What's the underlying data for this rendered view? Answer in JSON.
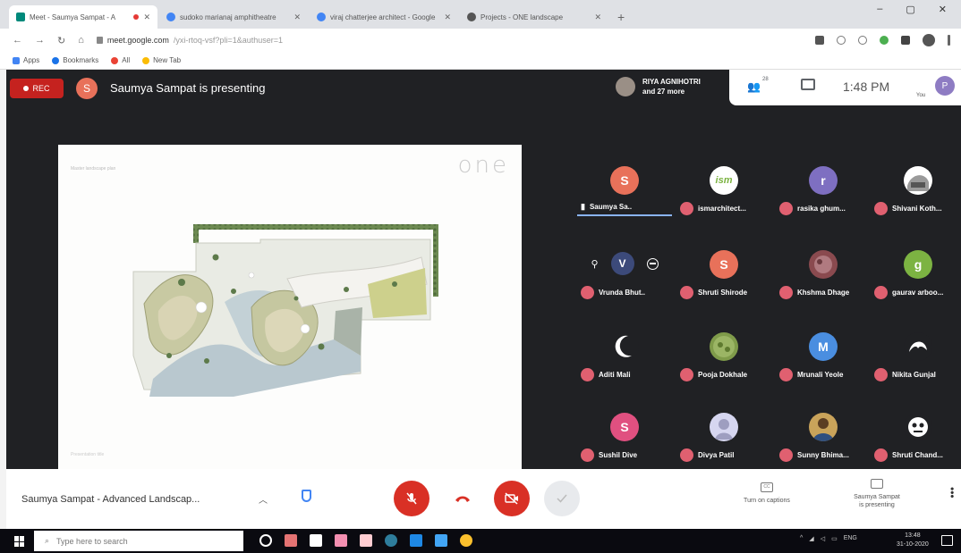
{
  "browser": {
    "tabs": [
      {
        "title": "Meet - Saumya Sampat - A",
        "recording": true,
        "fav": "#00897b"
      },
      {
        "title": "sudoko marianaj amphitheatre",
        "recording": false,
        "fav": "#4285f4"
      },
      {
        "title": "viraj chatterjee architect - Google",
        "recording": false,
        "fav": "#4285f4"
      },
      {
        "title": "Projects - ONE landscape",
        "recording": false,
        "fav": "#555555"
      }
    ],
    "new_tab": "+",
    "window_controls": {
      "minimize": "–",
      "maximize": "▢",
      "close": "✕"
    },
    "url_host": "meet.google.com",
    "url_path": "/yxi-rtoq-vsf?pli=1&authuser=1",
    "bookmarks": [
      "Apps",
      "Bookmarks",
      "All",
      "New Tab"
    ]
  },
  "meet": {
    "rec_label": "REC",
    "presenter_initial": "S",
    "presenter_banner": "Saumya Sampat is presenting",
    "participants_summary": {
      "name": "RIYA AGNIHOTRI",
      "more": "and 27 more"
    },
    "people_count": "28",
    "clock": "1:48 PM",
    "you_label": "You",
    "you_initial": "P",
    "tiles": [
      {
        "name": "Saumya Sa..",
        "initial": "S",
        "color": "#e8715a",
        "speaking": true
      },
      {
        "name": "ismarchitect...",
        "initial": "ism",
        "color": "#ffffff"
      },
      {
        "name": "rasika ghum...",
        "initial": "r",
        "color": "#7e6fc1"
      },
      {
        "name": "Shivani Koth...",
        "initial": "",
        "color": "#bfbfbf"
      },
      {
        "name": "Vrunda Bhut..",
        "initial": "V",
        "color": "#3c4a7a",
        "hovered": true
      },
      {
        "name": "Shruti Shirode",
        "initial": "S",
        "color": "#e8715a"
      },
      {
        "name": "Khshma Dhage",
        "initial": "",
        "color": "#8a4a4f"
      },
      {
        "name": "gaurav arboo...",
        "initial": "g",
        "color": "#7cb342"
      },
      {
        "name": "Aditi Mali",
        "initial": "",
        "color": "#ffffff"
      },
      {
        "name": "Pooja Dokhale",
        "initial": "",
        "color": "#7f9b4a"
      },
      {
        "name": "Mrunali Yeole",
        "initial": "M",
        "color": "#4a8ee0"
      },
      {
        "name": "Nikita Gunjal",
        "initial": "",
        "color": "#ffffff"
      },
      {
        "name": "Sushil Dive",
        "initial": "S",
        "color": "#e05080"
      },
      {
        "name": "Divya Patil",
        "initial": "",
        "color": "#d6d6f0"
      },
      {
        "name": "Sunny Bhima...",
        "initial": "",
        "color": "#c9a35a"
      },
      {
        "name": "Shruti Chand...",
        "initial": "",
        "color": "#ffffff"
      }
    ],
    "slide": {
      "caption": "Master landscape plan",
      "logo": "one",
      "footer": "Presentation title"
    },
    "bottom": {
      "meeting_name": "Saumya Sampat - Advanced Landscap...",
      "captions_label": "Turn on captions",
      "captions_icon": "CC",
      "presenting_line1": "Saumya Sampat",
      "presenting_line2": "is presenting"
    }
  },
  "taskbar": {
    "search_placeholder": "Type here to search",
    "time": "13:48",
    "date": "31-10-2020",
    "lang": "ENG"
  }
}
